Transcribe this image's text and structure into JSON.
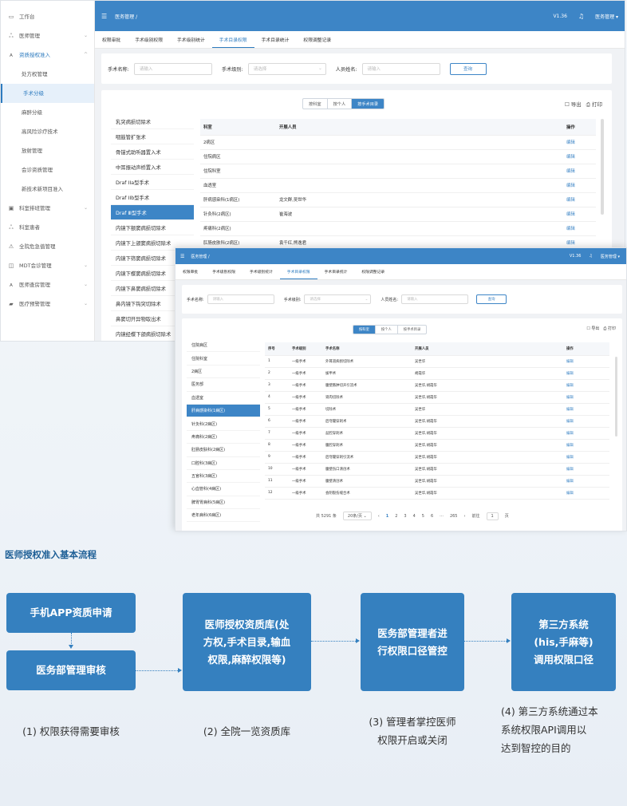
{
  "app": {
    "breadcrumb": "医务管理 /",
    "version": "V1.36",
    "user": "医务管理 ▾"
  },
  "sidebar": [
    {
      "label": "工作台",
      "icon": "▭",
      "level": 1
    },
    {
      "label": "医师管理",
      "icon": "ஃ",
      "level": 1,
      "arrow": "⌄"
    },
    {
      "label": "资质授权准入",
      "icon": "ᴀ",
      "level": 1,
      "arrow": "^",
      "blue": true
    },
    {
      "label": "处方权管理",
      "level": 2
    },
    {
      "label": "手术分级",
      "level": 2,
      "selected": true
    },
    {
      "label": "麻醉分级",
      "level": 2
    },
    {
      "label": "高风险诊疗技术",
      "level": 2
    },
    {
      "label": "放射管理",
      "level": 2
    },
    {
      "label": "会诊资质管理",
      "level": 2
    },
    {
      "label": "新技术新项目准入",
      "level": 2
    },
    {
      "label": "科室排班管理",
      "icon": "▣",
      "level": 1,
      "arrow": "⌄"
    },
    {
      "label": "科室患者",
      "icon": "ஃ",
      "level": 1
    },
    {
      "label": "全院危急值管理",
      "icon": "⚠",
      "level": 1
    },
    {
      "label": "MDT会诊管理",
      "icon": "◫",
      "level": 1,
      "arrow": "⌄"
    },
    {
      "label": "医师查房管理",
      "icon": "ᴀ",
      "level": 1,
      "arrow": "⌄"
    },
    {
      "label": "医疗预警管理",
      "icon": "▰",
      "level": 1,
      "arrow": "⌄"
    }
  ],
  "tabs": [
    "权限审批",
    "手术级别权限",
    "手术级别统计",
    "手术目录权限",
    "手术目录统计",
    "权限调整记录"
  ],
  "active_tab": 3,
  "search": {
    "name_label": "手术名称:",
    "name_placeholder": "请输入",
    "level_label": "手术级别:",
    "level_placeholder": "请选择",
    "person_label": "人员姓名:",
    "person_placeholder": "请输入",
    "query_button": "查询"
  },
  "segments": [
    "按科室",
    "按个人",
    "按手术目录"
  ],
  "export_label": "☐ 导出",
  "print_label": "⎙ 打印",
  "s1": {
    "surgeries": [
      "乳突病损切除术",
      "咽鼓管扩张术",
      "骨锚式助听器置入术",
      "中耳振动声桥置入术",
      "Draf IIa型手术",
      "Draf IIb型手术",
      "Draf Ⅲ型手术",
      "内镜下额窦病损切除术",
      "内镜下上颌窦病损切除术",
      "内镜下筛窦病损切除术",
      "内镜下蝶窦病损切除术",
      "内镜下鼻窦病损切除术",
      "鼻内镜下钩突切除术",
      "鼻窦切开异物取出术",
      "内镜经蝶下颌病损切除术"
    ],
    "selected_surgery": 6,
    "headers": [
      "科室",
      "开展人员",
      "操作"
    ],
    "rows": [
      [
        "2病区",
        "",
        "编辑"
      ],
      [
        "住院病区",
        "",
        "编辑"
      ],
      [
        "住院科室",
        "",
        "编辑"
      ],
      [
        "血透室",
        "",
        "编辑"
      ],
      [
        "肝病感染科(1病区)",
        "龙文群,吴世华",
        "编辑"
      ],
      [
        "针灸科(2病区)",
        "崔海波",
        "编辑"
      ],
      [
        "疼痛科(2病区)",
        "",
        "编辑"
      ],
      [
        "肛肠皮肤科(2病区)",
        "袁千红,熊逸君",
        "编辑"
      ]
    ]
  },
  "s2": {
    "departments": [
      "住院病区",
      "住院科室",
      "2病区",
      "医务部",
      "血透室",
      "肝病感染科(1病区)",
      "针灸科(2病区)",
      "疼痛科(2病区)",
      "肛肠皮肤科(2病区)",
      "口腔科(3病区)",
      "五官科(3病区)",
      "心血管科(4病区)",
      "脾胃胃病科(5病区)",
      "老年病科(6病区)"
    ],
    "selected_department": 5,
    "headers": [
      "序号",
      "手术级别",
      "手术名称",
      "开展人员",
      "操作"
    ],
    "rows": [
      [
        "1",
        "一级手术",
        "外耳道病损切除术",
        "吴世华",
        "编辑"
      ],
      [
        "2",
        "一级手术",
        "拔甲术",
        "胡霞华",
        "编辑"
      ],
      [
        "3",
        "一级手术",
        "腹壁脓肿切开引流术",
        "吴世华,胡霞华",
        "编辑"
      ],
      [
        "4",
        "一级手术",
        "肾肉切除术",
        "吴世华,胡霞华",
        "编辑"
      ],
      [
        "5",
        "一级手术",
        "切除术",
        "吴世华",
        "编辑"
      ],
      [
        "6",
        "一级手术",
        "后穹窿穿刺术",
        "吴世华,胡霞华",
        "编辑"
      ],
      [
        "7",
        "一级手术",
        "盆腔穿刺术",
        "吴世华,胡霞华",
        "编辑"
      ],
      [
        "8",
        "一级手术",
        "腹腔穿刺术",
        "吴世华,胡霞华",
        "编辑"
      ],
      [
        "9",
        "一级手术",
        "后穹窿穿刺引流术",
        "吴世华,胡霞华",
        "编辑"
      ],
      [
        "10",
        "一级手术",
        "腹壁伤口清创术",
        "吴世华,胡霞华",
        "编辑"
      ],
      [
        "11",
        "一级手术",
        "腹壁清创术",
        "吴世华,胡霞华",
        "编辑"
      ],
      [
        "12",
        "一级手术",
        "会阴裂伤缝合术",
        "吴世华,胡霞华",
        "编辑"
      ]
    ],
    "pagination": {
      "total": "共 5291 条",
      "page_size": "20条/页 ⌄",
      "prev": "‹",
      "pages": [
        "1",
        "2",
        "3",
        "4",
        "5",
        "6",
        "···",
        "265"
      ],
      "next": "›",
      "goto_label": "前往",
      "goto_value": "1",
      "goto_suffix": "页"
    }
  },
  "flow": {
    "title": "医师授权准入基本流程",
    "box1": "手机APP资质申请",
    "box2": "医务部管理审核",
    "box3": "医师授权资质库(处\n方权,手术目录,输血\n权限,麻醉权限等)",
    "box4": "医务部管理者进\n行权限口径管控",
    "box5": "第三方系统\n(his,手麻等)\n调用权限口径",
    "cap1": "(1) 权限获得需要审核",
    "cap2": "(2) 全院一览资质库",
    "cap3": "(3) 管理者掌控医师\n权限开启或关闭",
    "cap4": "(4) 第三方系统通过本\n系统权限API调用以\n达到智控的目的"
  },
  "colors": {
    "accent": "#3d85c6",
    "flow_box": "#3580bf",
    "title": "#1e5f96"
  }
}
